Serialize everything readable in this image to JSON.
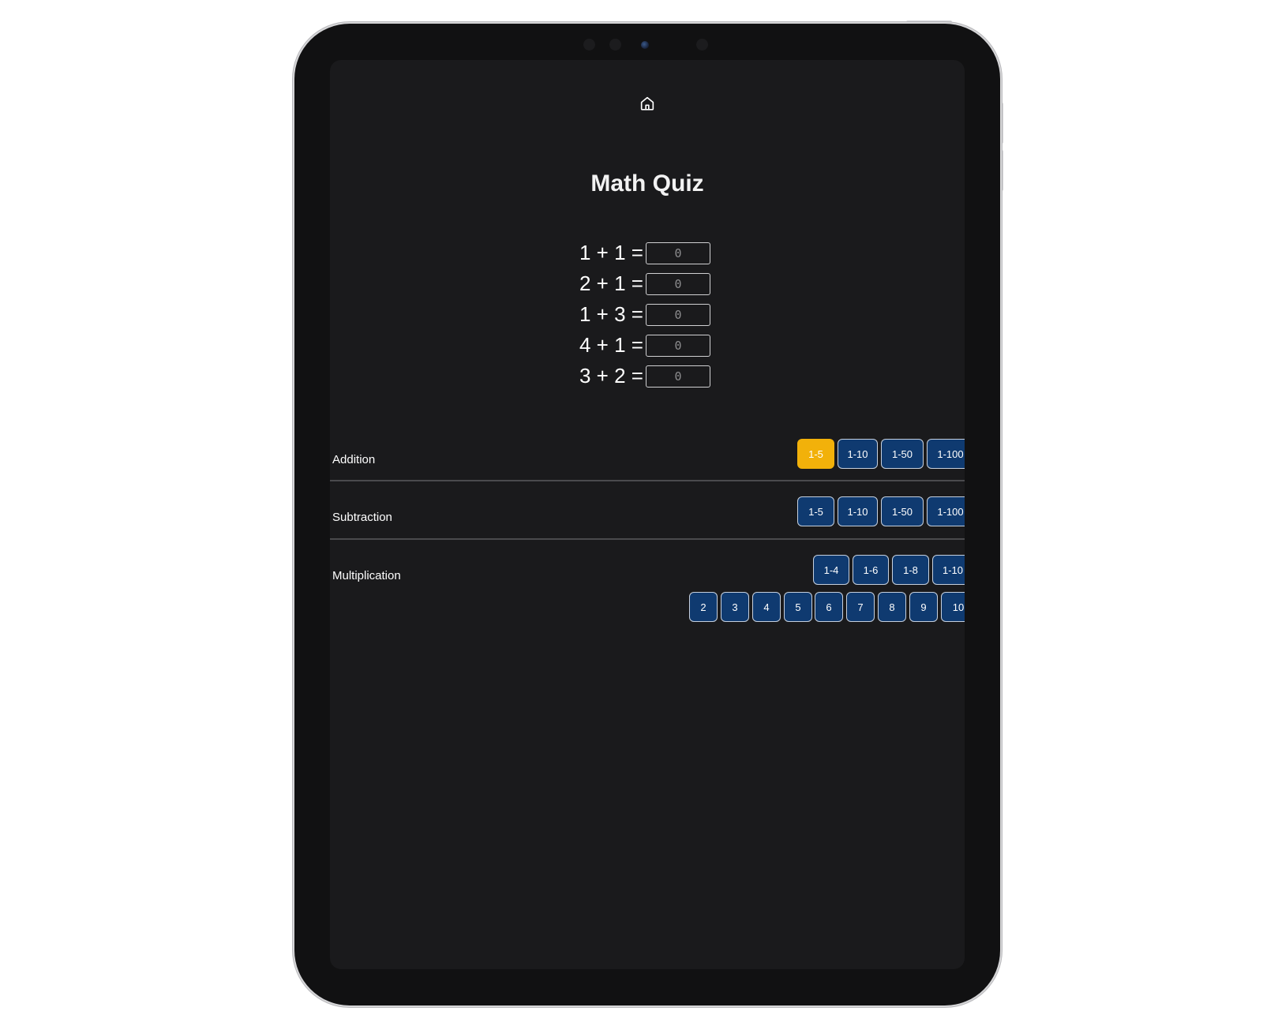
{
  "app": {
    "title": "Math Quiz",
    "home_icon": "home-icon"
  },
  "quiz": {
    "questions": [
      {
        "text": "1 + 1 =",
        "placeholder": "0"
      },
      {
        "text": "2 + 1 =",
        "placeholder": "0"
      },
      {
        "text": "1 + 3 =",
        "placeholder": "0"
      },
      {
        "text": "4 + 1 =",
        "placeholder": "0"
      },
      {
        "text": "3 + 2 =",
        "placeholder": "0"
      }
    ]
  },
  "sections": {
    "addition": {
      "label": "Addition",
      "ranges": [
        "1-5",
        "1-10",
        "1-50",
        "1-100"
      ],
      "selected": "1-5"
    },
    "subtraction": {
      "label": "Subtraction",
      "ranges": [
        "1-5",
        "1-10",
        "1-50",
        "1-100"
      ]
    },
    "multiplication": {
      "label": "Multiplication",
      "ranges": [
        "1-4",
        "1-6",
        "1-8",
        "1-10"
      ],
      "tables": [
        "2",
        "3",
        "4",
        "5",
        "6",
        "7",
        "8",
        "9",
        "10"
      ]
    }
  },
  "colors": {
    "button_bg": "#0f3a70",
    "selected_bg": "#f2b10a",
    "screen_bg": "#1a1a1c"
  }
}
